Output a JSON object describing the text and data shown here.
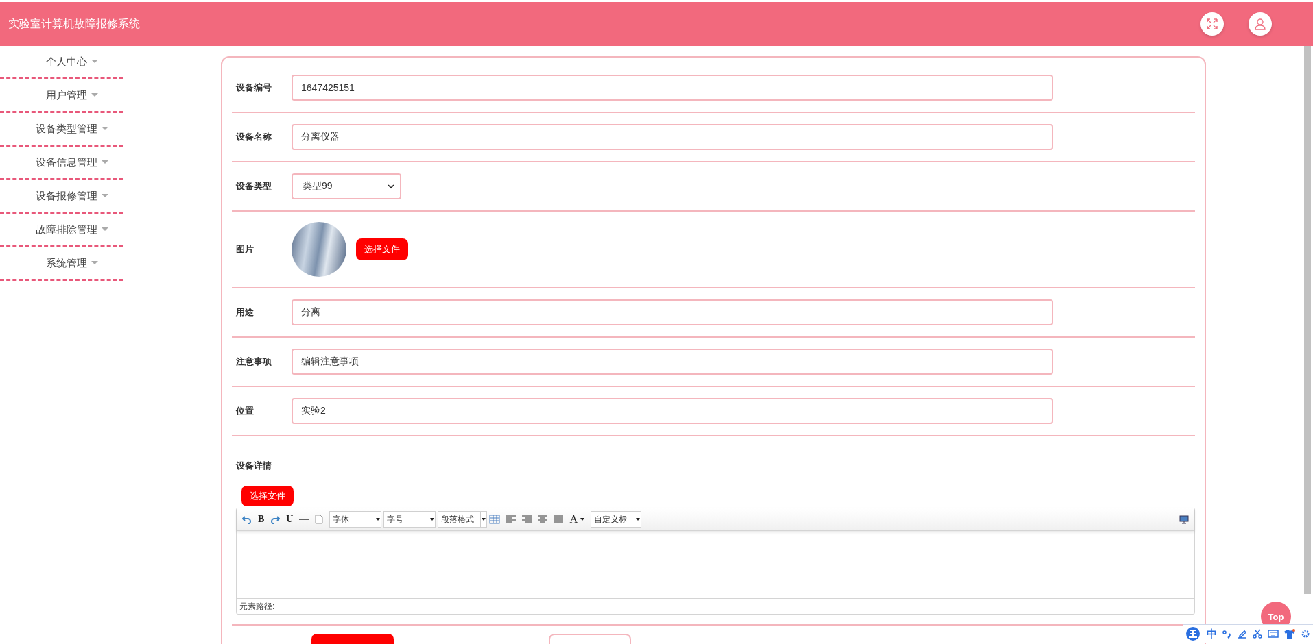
{
  "header": {
    "title": "实验室计算机故障报修系统"
  },
  "sidebar": {
    "items": [
      {
        "label": "个人中心"
      },
      {
        "label": "用户管理"
      },
      {
        "label": "设备类型管理"
      },
      {
        "label": "设备信息管理"
      },
      {
        "label": "设备报修管理"
      },
      {
        "label": "故障排除管理"
      },
      {
        "label": "系统管理"
      }
    ]
  },
  "form": {
    "fields": [
      {
        "kind": "text",
        "label": "设备编号",
        "value": "1647425151"
      },
      {
        "kind": "text",
        "label": "设备名称",
        "value": "分离仪器"
      },
      {
        "kind": "select",
        "label": "设备类型",
        "value": "类型99"
      },
      {
        "kind": "image",
        "label": "图片",
        "button": "选择文件"
      },
      {
        "kind": "text",
        "label": "用途",
        "value": "分离"
      },
      {
        "kind": "text",
        "label": "注意事项",
        "value": "编辑注意事项"
      },
      {
        "kind": "text",
        "label": "位置",
        "value": "实验2"
      }
    ],
    "editor": {
      "label": "设备详情",
      "button": "选择文件",
      "bold": "B",
      "underline": "U",
      "font_color": "A",
      "dropdowns": [
        "字体",
        "字号",
        "段落格式"
      ],
      "custom": "自定义标",
      "path_label": "元素路径:"
    }
  },
  "top_button": "Top",
  "ime_bar": {
    "mode": "中"
  }
}
